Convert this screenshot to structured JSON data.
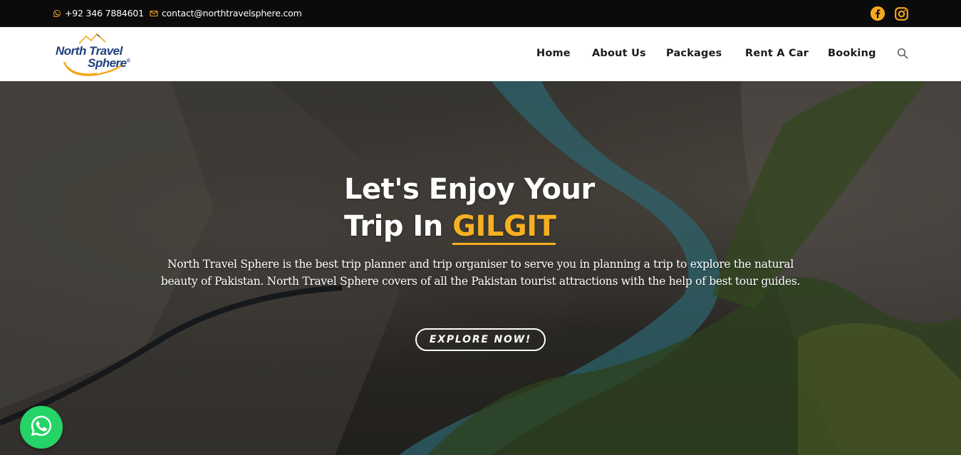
{
  "topbar": {
    "phone": "+92 346 7884601",
    "email": "contact@northtravelsphere.com",
    "phone_icon": "whatsapp-icon",
    "email_icon": "envelope-icon",
    "social": [
      "facebook-icon",
      "instagram-icon"
    ],
    "accent_color": "#f6a821"
  },
  "header": {
    "logo": {
      "line1": "North Travel",
      "line2": "Sphere",
      "mark": "®"
    },
    "nav": [
      "Home",
      "About Us",
      "Packages",
      "Rent A Car",
      "Booking"
    ],
    "search_icon": "search-icon"
  },
  "hero": {
    "title_line1": "Let's Enjoy Your",
    "title_line2_prefix": "Trip In ",
    "title_highlight": "GILGIT",
    "highlight_color": "#f6b021",
    "description": "North Travel Sphere is the best trip planner and trip organiser to serve you in planning a trip to explore the natural beauty of Pakistan. North Travel Sphere covers of all the Pakistan tourist attractions with the help of best tour guides.",
    "cta": "EXPLORE NOW!"
  },
  "floating": {
    "whatsapp_icon": "whatsapp-icon",
    "whatsapp_color": "#25d366"
  }
}
